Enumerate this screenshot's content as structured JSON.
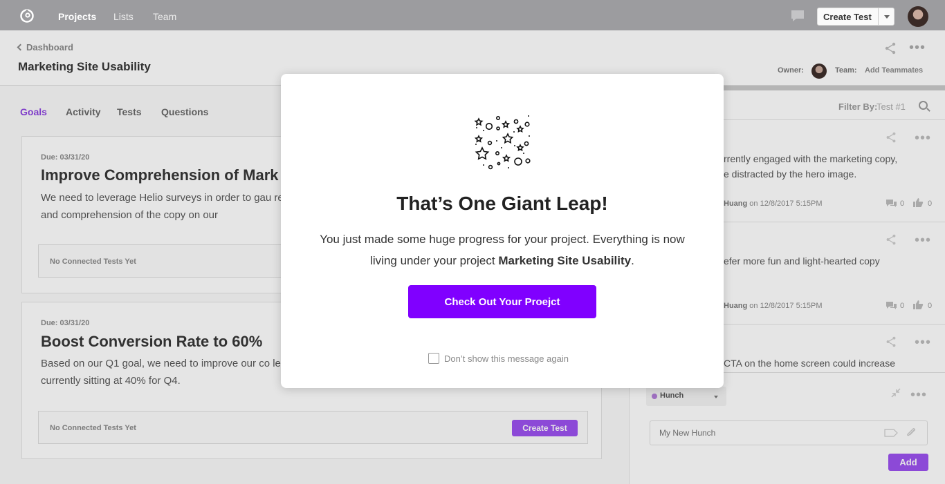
{
  "topnav": {
    "items": [
      "Projects",
      "Lists",
      "Team"
    ],
    "create_test": "Create Test"
  },
  "header": {
    "breadcrumb": "Dashboard",
    "title": "Marketing Site Usability",
    "owner_label": "Owner:",
    "team_label": "Team:",
    "add_teammates": "Add Teammates"
  },
  "tabs": [
    "Goals",
    "Activity",
    "Tests",
    "Questions"
  ],
  "goals": [
    {
      "due": "Due: 03/31/20",
      "title": "Improve Comprehension of Mark",
      "desc": "We need to leverage Helio surveys in order to gau readability and comprehension of the copy on our",
      "tests": "No Connected Tests Yet"
    },
    {
      "due": "Due: 03/31/20",
      "title": "Boost Conversion Rate to 60%",
      "desc": "Based on our Q1 goal, we need to improve our co leads. We’re currently sitting at 40% for Q4.",
      "tests": "No Connected Tests Yet",
      "create_test": "Create Test"
    }
  ],
  "right_panel": {
    "filter_label": "Filter By:",
    "filter_value": "Test #1",
    "hunches": [
      {
        "line1": "rrently engaged with the marketing copy,",
        "line2": "e distracted by the hero image.",
        "author": "Huang",
        "date": "on 12/8/2017 5:15PM",
        "comments": "0",
        "likes": "0"
      },
      {
        "line1": "efer more fun and light-hearted copy",
        "line2": "",
        "author": "Huang",
        "date": "on 12/8/2017 5:15PM",
        "comments": "0",
        "likes": "0"
      },
      {
        "line1": "CTA on the home screen could increase",
        "line2": "",
        "author": "",
        "date": "",
        "comments": "",
        "likes": ""
      }
    ],
    "hunch_type": "Hunch",
    "new_hunch_placeholder": "My New Hunch",
    "add": "Add"
  },
  "modal": {
    "title": "That’s One Giant Leap!",
    "body_1": "You just made some huge progress for your project. Everything is now living under your project",
    "project": "Marketing Site Usability",
    "body_end": ".",
    "cta": "Check Out Your Proejct",
    "checkbox_label": "Don’t show this message again"
  },
  "colors": {
    "accent": "#8000ff",
    "accent_soft": "#9a4ef0",
    "nav_bg": "#9c9c9f"
  }
}
